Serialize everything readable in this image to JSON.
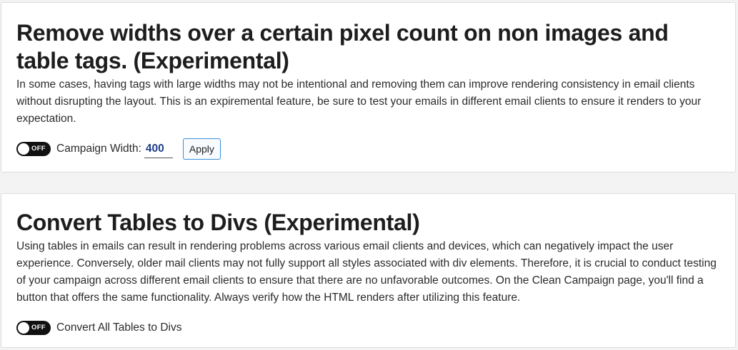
{
  "settings": [
    {
      "title": "Remove widths over a certain pixel count on non images and table tags. (Experimental)",
      "description": "In some cases, having tags with large widths may not be intentional and removing them can improve rendering consistency in email clients without disrupting the layout. This is an expiremental feature, be sure to test your emails in different email clients to ensure it renders to your expectation.",
      "toggle_state": "OFF",
      "control_label": "Campaign Width:",
      "width_value": "400",
      "apply_label": "Apply"
    },
    {
      "title": "Convert Tables to Divs (Experimental)",
      "description": "Using tables in emails can result in rendering problems across various email clients and devices, which can negatively impact the user experience. Conversely, older mail clients may not fully support all styles associated with div elements. Therefore, it is crucial to conduct testing of your campaign across different email clients to ensure that there are no unfavorable outcomes. On the Clean Campaign page, you'll find a button that offers the same functionality. Always verify how the HTML renders after utilizing this feature.",
      "toggle_state": "OFF",
      "control_label": "Convert All Tables to Divs"
    }
  ],
  "colors": {
    "toggle_bg": "#111111",
    "input_value": "#1f3f88",
    "button_border": "#3a8fd9"
  }
}
